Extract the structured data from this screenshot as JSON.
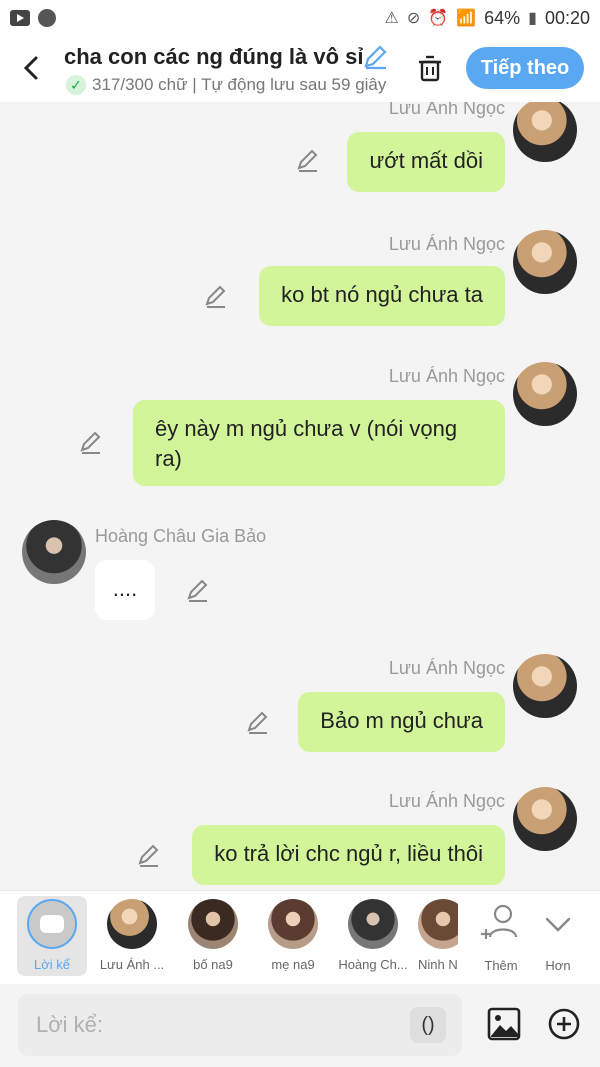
{
  "status_bar": {
    "battery": "64%",
    "time": "00:20"
  },
  "header": {
    "title": "cha con các ng đúng là vô sỉ",
    "subtitle": "317/300 chữ | Tự động lưu sau 59 giây",
    "next_button": "Tiếp theo"
  },
  "messages": [
    {
      "sender": "Lưu Ánh Ngọc",
      "text": "ướt mất dồi"
    },
    {
      "sender": "Lưu Ánh Ngọc",
      "text": "ko bt nó ngủ chưa ta"
    },
    {
      "sender": "Lưu Ánh Ngọc",
      "text": "êy này m ngủ chưa v (nói vọng ra)"
    },
    {
      "sender": "Hoàng Châu Gia Bảo",
      "text": "...."
    },
    {
      "sender": "Lưu Ánh Ngọc",
      "text": "Bảo m ngủ chưa"
    },
    {
      "sender": "Lưu Ánh Ngọc",
      "text": "ko trả lời chc ngủ r, liều thôi"
    }
  ],
  "characters": [
    {
      "label": "Lời kể"
    },
    {
      "label": "Lưu Ánh ..."
    },
    {
      "label": "bố na9"
    },
    {
      "label": "mẹ na9"
    },
    {
      "label": "Hoàng Ch..."
    },
    {
      "label": "Ninh N..."
    },
    {
      "label": "Thêm"
    },
    {
      "label": "Hơn"
    }
  ],
  "input": {
    "placeholder": "Lời kể:",
    "paren_button": "()"
  },
  "colors": {
    "accent": "#5aa7f2",
    "bubble_right": "#d2f59a",
    "bubble_left": "#ffffff"
  }
}
